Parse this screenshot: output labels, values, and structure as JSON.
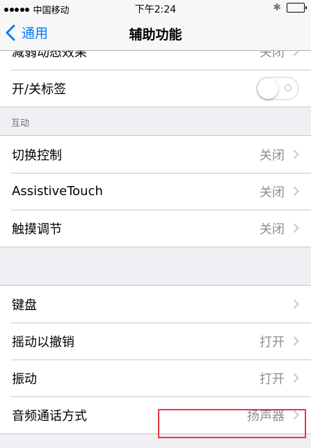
{
  "status_bar": {
    "carrier": "中国移动",
    "time": "下午2:24"
  },
  "nav": {
    "back_label": "通用",
    "title": "辅助功能"
  },
  "rows_top": [
    {
      "label": "减弱动态效果",
      "value": "关闭"
    }
  ],
  "toggle_row": {
    "label": "开/关标签",
    "toggle_on": false
  },
  "interaction": {
    "header": "互动",
    "items": [
      {
        "label": "切换控制",
        "value": "关闭"
      },
      {
        "label": "AssistiveTouch",
        "value": "关闭"
      },
      {
        "label": "触摸调节",
        "value": "关闭"
      }
    ]
  },
  "misc": {
    "items": [
      {
        "label": "键盘",
        "value": ""
      },
      {
        "label": "摇动以撤销",
        "value": "打开"
      },
      {
        "label": "振动",
        "value": "打开"
      },
      {
        "label": "音频通话方式",
        "value": "扬声器"
      }
    ]
  },
  "colors": {
    "accent": "#007aff",
    "highlight": "#e03a44",
    "background": "#efeff4"
  }
}
